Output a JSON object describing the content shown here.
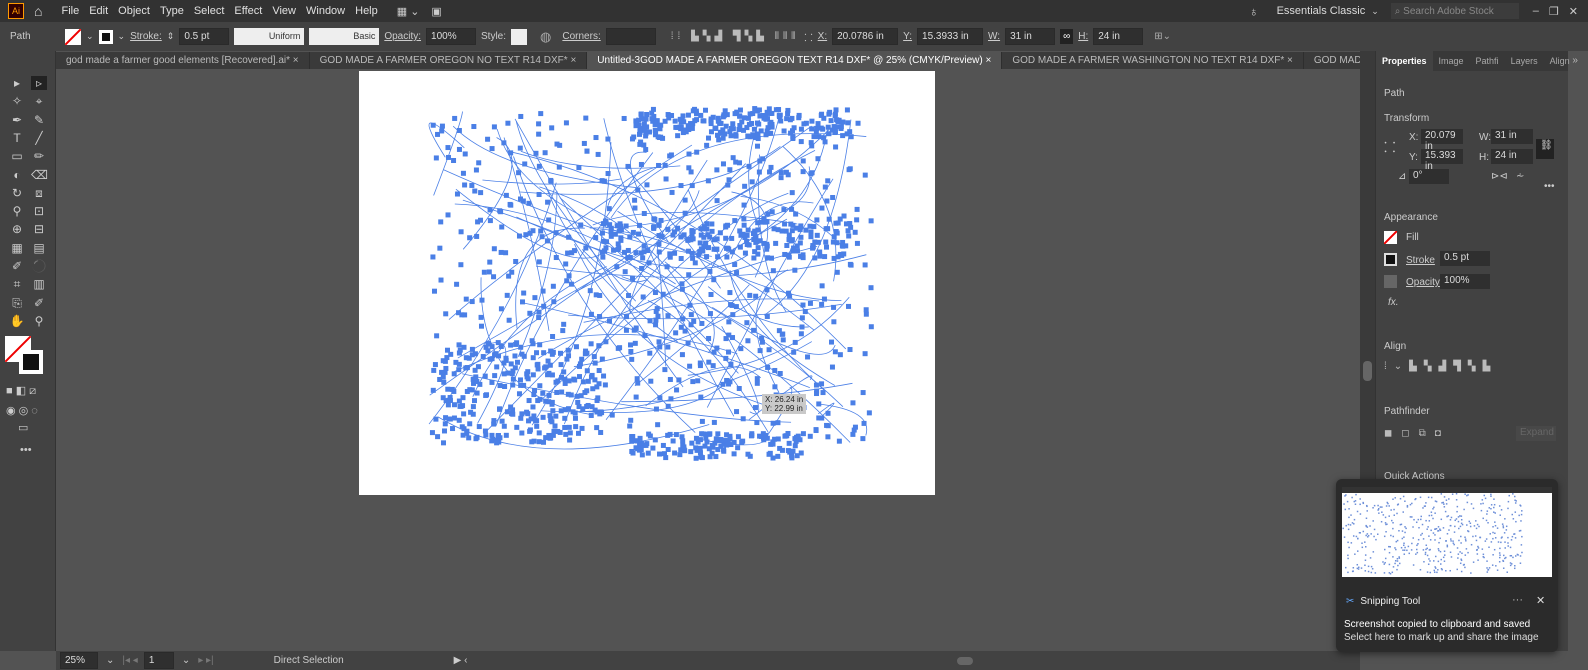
{
  "app": {
    "logo": "Ai",
    "menu": [
      "File",
      "Edit",
      "Object",
      "Type",
      "Select",
      "Effect",
      "View",
      "Window",
      "Help"
    ],
    "workspace": "Essentials Classic",
    "search_placeholder": "Search Adobe Stock"
  },
  "control": {
    "object_type": "Path",
    "stroke_label": "Stroke:",
    "stroke_value": "0.5 pt",
    "profile": "Uniform",
    "brush": "Basic",
    "opacity_label": "Opacity:",
    "opacity_value": "100%",
    "style_label": "Style:",
    "corners_label": "Corners:",
    "x_label": "X:",
    "x": "20.0786 in",
    "y_label": "Y:",
    "y": "15.3933 in",
    "w_label": "W:",
    "w": "31 in",
    "h_label": "H:",
    "h": "24 in"
  },
  "tabs": [
    {
      "label": "god made a farmer good elements [Recovered].ai*",
      "active": false
    },
    {
      "label": "GOD MADE A FARMER OREGON NO TEXT R14 DXF*",
      "active": false
    },
    {
      "label": "Untitled-3GOD MADE A FARMER OREGON TEXT R14 DXF* @ 25% (CMYK/Preview)",
      "active": true
    },
    {
      "label": "GOD MADE A FARMER WASHINGTON NO TEXT R14 DXF*",
      "active": false
    },
    {
      "label": "GOD MADE A FARMER WASHINGTON TEXT R14 D",
      "active": false
    }
  ],
  "tooltip": {
    "x": "X: 26.24 in",
    "y": "Y: 22.99 in"
  },
  "panel": {
    "tabs": [
      "Properties",
      "Image",
      "Pathfi",
      "Layers",
      "Align"
    ],
    "object_type": "Path",
    "transform": "Transform",
    "x_label": "X:",
    "x": "20.079 in",
    "y_label": "Y:",
    "y": "15.393 in",
    "w_label": "W:",
    "w": "31 in",
    "h_label": "H:",
    "h": "24 in",
    "angle": "0°",
    "appearance": "Appearance",
    "fill": "Fill",
    "stroke": "Stroke",
    "stroke_value": "0.5 pt",
    "opacity": "Opacity",
    "opacity_value": "100%",
    "fx": "fx.",
    "align": "Align",
    "pathfinder": "Pathfinder",
    "expand": "Expand",
    "quick_actions": "Quick Actions"
  },
  "status": {
    "zoom": "25%",
    "page": "1",
    "tool": "Direct Selection"
  },
  "toast": {
    "app": "Snipping Tool",
    "title": "Screenshot copied to clipboard and saved",
    "body": "Select here to mark up and share the image"
  },
  "colors": {
    "selection": "#4a7fe6",
    "artboard": "#ffffff"
  }
}
